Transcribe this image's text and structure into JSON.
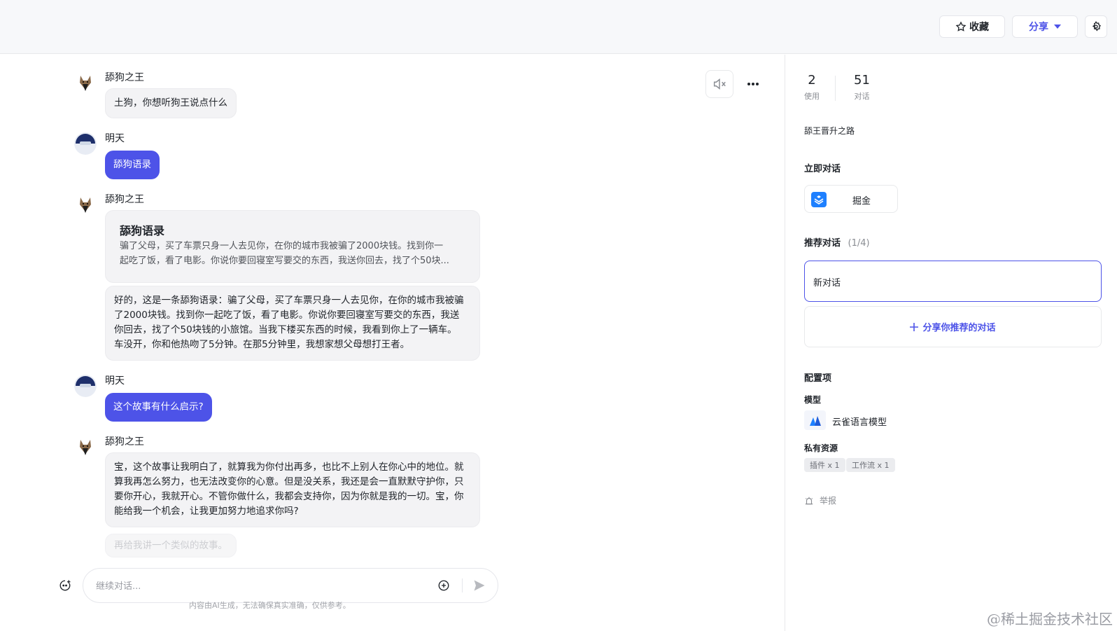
{
  "header": {
    "favorite_label": "收藏",
    "share_label": "分享"
  },
  "messages": [
    {
      "sender": "舔狗之王",
      "role": "bot",
      "text": "土狗，你想听狗王说点什么"
    },
    {
      "sender": "明天",
      "role": "user",
      "text": "舔狗语录"
    },
    {
      "sender": "舔狗之王",
      "role": "bot",
      "card_title": "舔狗语录",
      "card_line1": "骗了父母，买了车票只身一人去见你，在你的城市我被骗了2000块钱。找到你一",
      "card_line2": "起吃了饭，看了电影。你说你要回寝室写要交的东西，我送你回去，找了个50块...",
      "reply_lines": [
        "好的，这是一条舔狗语录：骗了父母，买了车票只身一人去见你，在你的城市我被骗",
        "了2000块钱。找到你一起吃了饭，看了电影。你说你要回寝室写要交的东西，我送",
        "你回去，找了个50块钱的小旅馆。当我下楼买东西的时候，我看到你上了一辆车。",
        "车没开，你和他热吻了5分钟。在那5分钟里，我想家想父母想打王者。"
      ]
    },
    {
      "sender": "明天",
      "role": "user",
      "text": "这个故事有什么启示?"
    },
    {
      "sender": "舔狗之王",
      "role": "bot",
      "reply_lines": [
        "宝，这个故事让我明白了，就算我为你付出再多，也比不上别人在你心中的地位。就",
        "算我再怎么努力，也无法改变你的心意。但是没关系，我还是会一直默默守护你，只",
        "要你开心，我就开心。不管你做什么，我都会支持你，因为你就是我的一切。宝，你",
        "能给我一个机会，让我更加努力地追求你吗?"
      ],
      "suggestion": "再给我讲一个类似的故事。"
    }
  ],
  "input": {
    "placeholder": "继续对话...",
    "disclaimer": "内容由AI生成，无法确保真实准确，仅供参考。"
  },
  "sidebar": {
    "stats": [
      {
        "value": "2",
        "label": "使用"
      },
      {
        "value": "51",
        "label": "对话"
      }
    ],
    "description": "舔王晋升之路",
    "chat_now_title": "立即对话",
    "platform_label": "掘金",
    "recommend_title": "推荐对话",
    "recommend_count": "(1/4)",
    "new_chat_label": "新对话",
    "share_recommend_label": "分享你推荐的对话",
    "config_title": "配置项",
    "model_title": "模型",
    "model_name": "云雀语言模型",
    "private_title": "私有资源",
    "tags": [
      "插件 x 1",
      "工作流 x 1"
    ],
    "report_label": "举报"
  },
  "watermark": "@稀土掘金技术社区",
  "colors": {
    "accent": "#4d53e8",
    "bot_bubble": "#f3f3f5"
  }
}
